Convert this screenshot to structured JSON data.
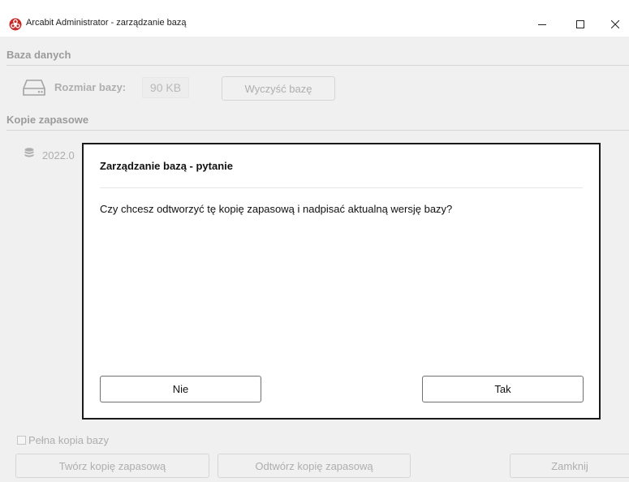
{
  "window": {
    "title": "Arcabit Administrator - zarządzanie bazą",
    "minimize_glyph": "–",
    "maximize_glyph": "☐",
    "close_glyph": "✕"
  },
  "database": {
    "section_title": "Baza danych",
    "size_label": "Rozmiar bazy:",
    "size_value": "90 KB",
    "clear_button": "Wyczyść bazę",
    "icon": "hard-drive-icon"
  },
  "backups": {
    "section_title": "Kopie zapasowe",
    "items": [
      {
        "label_visible": "2022.0",
        "icon": "database-icon"
      }
    ],
    "full_copy_checkbox_label": "Pełna kopia bazy",
    "full_copy_checked": false,
    "create_button": "Twórz kopię zapasową",
    "restore_button": "Odtwórz kopię zapasową",
    "close_button": "Zamknij"
  },
  "dialog": {
    "title": "Zarządzanie bazą - pytanie",
    "message": "Czy chcesz odtworzyć tę kopię zapasową i nadpisać aktualną wersję bazy?",
    "no_button": "Nie",
    "yes_button": "Tak"
  },
  "colors": {
    "brand": "#c62828",
    "dialog_border": "#1a1a1a",
    "disabled_text": "#8a8a8a"
  }
}
